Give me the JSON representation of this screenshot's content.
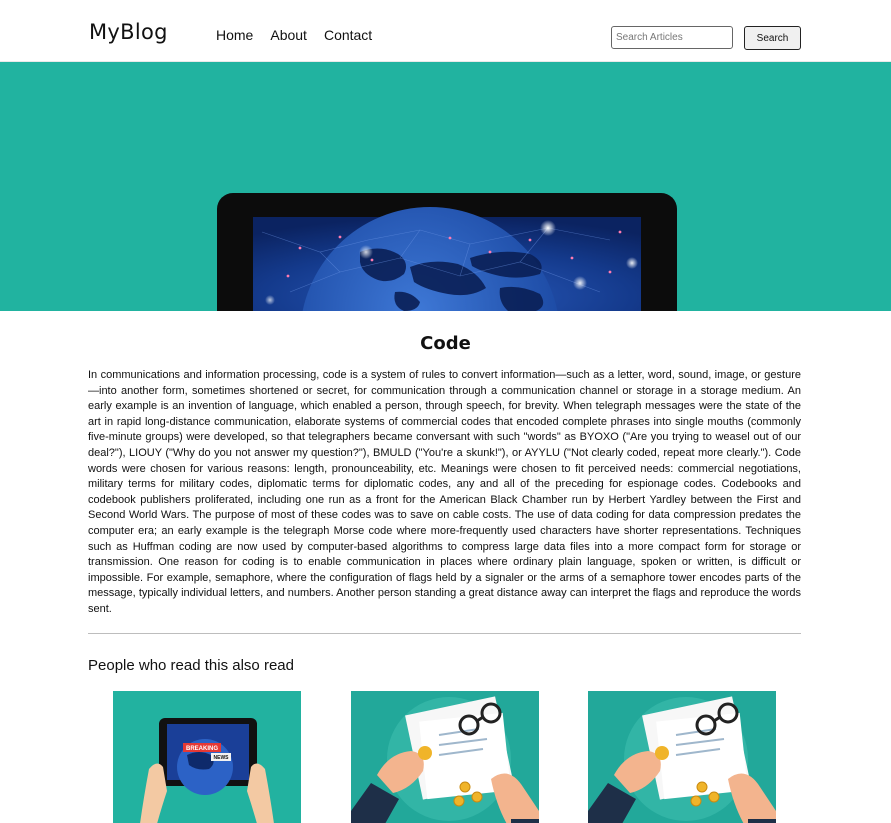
{
  "header": {
    "brand": "MyBlog",
    "nav": [
      {
        "label": "Home"
      },
      {
        "label": "About"
      },
      {
        "label": "Contact"
      }
    ],
    "search": {
      "placeholder": "Search Articles",
      "button_label": "Search"
    }
  },
  "hero": {
    "image": "tablet-world-map-illustration",
    "background_color": "#21b3a0"
  },
  "article": {
    "title": "Code",
    "body": "In communications and information processing, code is a system of rules to convert information—such as a letter, word, sound, image, or gesture—into another form, sometimes shortened or secret, for communication through a communication channel or storage in a storage medium. An early example is an invention of language, which enabled a person, through speech, for brevity. When telegraph messages were the state of the art in rapid long-distance communication, elaborate systems of commercial codes that encoded complete phrases into single mouths (commonly five-minute groups) were developed, so that telegraphers became conversant with such \"words\" as BYOXO (\"Are you trying to weasel out of our deal?\"), LIOUY (\"Why do you not answer my question?\"), BMULD (\"You're a skunk!\"), or AYYLU (\"Not clearly coded, repeat more clearly.\"). Code words were chosen for various reasons: length, pronounceability, etc. Meanings were chosen to fit perceived needs: commercial negotiations, military terms for military codes, diplomatic terms for diplomatic codes, any and all of the preceding for espionage codes. Codebooks and codebook publishers proliferated, including one run as a front for the American Black Chamber run by Herbert Yardley between the First and Second World Wars. The purpose of most of these codes was to save on cable costs. The use of data coding for data compression predates the computer era; an early example is the telegraph Morse code where more-frequently used characters have shorter representations. Techniques such as Huffman coding are now used by computer-based algorithms to compress large data files into a more compact form for storage or transmission. One reason for coding is to enable communication in places where ordinary plain language, spoken or written, is difficult or impossible. For example, semaphore, where the configuration of flags held by a signaler or the arms of a semaphore tower encodes parts of the message, typically individual letters, and numbers. Another person standing a great distance away can interpret the flags and reproduce the words sent."
  },
  "related": {
    "heading": "People who read this also read",
    "cards": [
      {
        "image": "hands-holding-tablet-breaking-news",
        "badge_top": "BREAKING",
        "badge_bottom": "NEWS"
      },
      {
        "image": "hands-signing-document-with-glasses-and-coins"
      },
      {
        "image": "hands-signing-document-with-glasses-and-coins"
      }
    ]
  }
}
